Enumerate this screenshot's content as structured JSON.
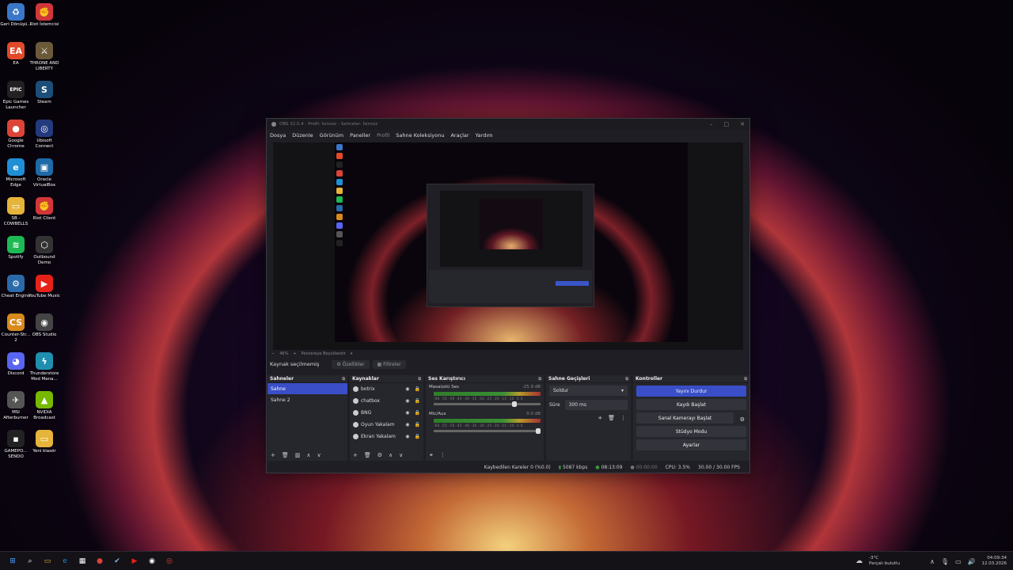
{
  "desktop": {
    "icons": [
      {
        "label": "Geri Dönüşü...",
        "glyph": "♻",
        "color": "#3a77c8"
      },
      {
        "label": "Riot İstemcisi",
        "glyph": "✊",
        "color": "#d13639"
      },
      {
        "label": "EA",
        "glyph": "EA",
        "color": "#e24a2a"
      },
      {
        "label": "THRONE AND LIBERTY",
        "glyph": "⚔",
        "color": "#6b5a3a"
      },
      {
        "label": "Epic Games Launcher",
        "glyph": "EPIC",
        "color": "#222"
      },
      {
        "label": "Steam",
        "glyph": "S",
        "color": "#1b4f7a"
      },
      {
        "label": "Google Chrome",
        "glyph": "●",
        "color": "#db4437"
      },
      {
        "label": "Ubisoft Connect",
        "glyph": "◎",
        "color": "#233a7e"
      },
      {
        "label": "Microsoft Edge",
        "glyph": "e",
        "color": "#1f8fd6"
      },
      {
        "label": "Oracle VirtualBox",
        "glyph": "▣",
        "color": "#1e6aa6"
      },
      {
        "label": "SB - COWBELLS",
        "glyph": "▭",
        "color": "#e6b43a"
      },
      {
        "label": "Riot Client",
        "glyph": "✊",
        "color": "#d13639"
      },
      {
        "label": "Spotify",
        "glyph": "≋",
        "color": "#1db954"
      },
      {
        "label": "Outbound Demo",
        "glyph": "⬡",
        "color": "#333"
      },
      {
        "label": "Cheat Engine",
        "glyph": "⚙",
        "color": "#2b6aa8"
      },
      {
        "label": "YouTube Music",
        "glyph": "▶",
        "color": "#e62117"
      },
      {
        "label": "Counter-Str... 2",
        "glyph": "CS",
        "color": "#d88a1c"
      },
      {
        "label": "OBS Studio",
        "glyph": "◉",
        "color": "#444"
      },
      {
        "label": "Discord",
        "glyph": "◕",
        "color": "#5865f2"
      },
      {
        "label": "Thunderstore Mod Mana...",
        "glyph": "ϟ",
        "color": "#1f8fb0"
      },
      {
        "label": "MSI Afterburner",
        "glyph": "✈",
        "color": "#555"
      },
      {
        "label": "NVIDIA Broadcast",
        "glyph": "▲",
        "color": "#76b900"
      },
      {
        "label": "GAMEPO... SENDO",
        "glyph": "▪",
        "color": "#222"
      },
      {
        "label": "Yeni klasör",
        "glyph": "▭",
        "color": "#e6b43a"
      }
    ]
  },
  "obs": {
    "title": "OBS 32.0.4 - Profil: İsimsiz - Sahneler: İsimsiz",
    "menu": [
      "Dosya",
      "Düzenle",
      "Görünüm",
      "Paneller",
      "Profil",
      "Sahne Koleksiyonu",
      "Araçlar",
      "Yardım"
    ],
    "zoom": {
      "minus": "−",
      "value": "46%",
      "plus": "+",
      "fit": "Pencereye Boyutlandır"
    },
    "source_bar": {
      "none_selected": "Kaynak seçilmemiş",
      "properties": "Özellikler",
      "filters": "Filtreler"
    },
    "scenes": {
      "header": "Sahneler",
      "items": [
        "Sahne",
        "Sahne 2"
      ]
    },
    "sources": {
      "header": "Kaynaklar",
      "items": [
        "botrix",
        "chatbox",
        "BNG",
        "Oyun Yakalam",
        "Ekran Yakalam"
      ]
    },
    "mixer": {
      "header": "Ses Karıştırıcı",
      "channels": [
        {
          "name": "Masaüstü Ses",
          "db": "-25.9 dB",
          "volume": 0.78
        },
        {
          "name": "Mic/Aux",
          "db": "0.0 dB",
          "volume": 1.0
        }
      ],
      "ticks": "-60 -55 -50 -45 -40 -35 -30 -25 -20 -15 -10 -5 0"
    },
    "transitions": {
      "header": "Sahne Geçişleri",
      "type": "Soldur",
      "duration_label": "Süre",
      "duration": "300 ms"
    },
    "controls": {
      "header": "Kontroller",
      "buttons": [
        "Yayını Durdur",
        "Kaydı Başlat",
        "Sanal Kamerayı Başlat",
        "Stüdyo Modu",
        "Ayarlar"
      ]
    },
    "status": {
      "dropped": "Kaybedilen Kareler 0 (%0.0)",
      "bitrate": "5087 kbps",
      "live_time": "08:13:09",
      "rec_time": "00:00:00",
      "cpu": "CPU: 3.5%",
      "fps": "30.00 / 30.00 FPS"
    }
  },
  "taskbar": {
    "weather": "-3°C",
    "weather_desc": "Parçalı bulutlu",
    "time": "04:09:34",
    "date": "12.03.2026"
  }
}
